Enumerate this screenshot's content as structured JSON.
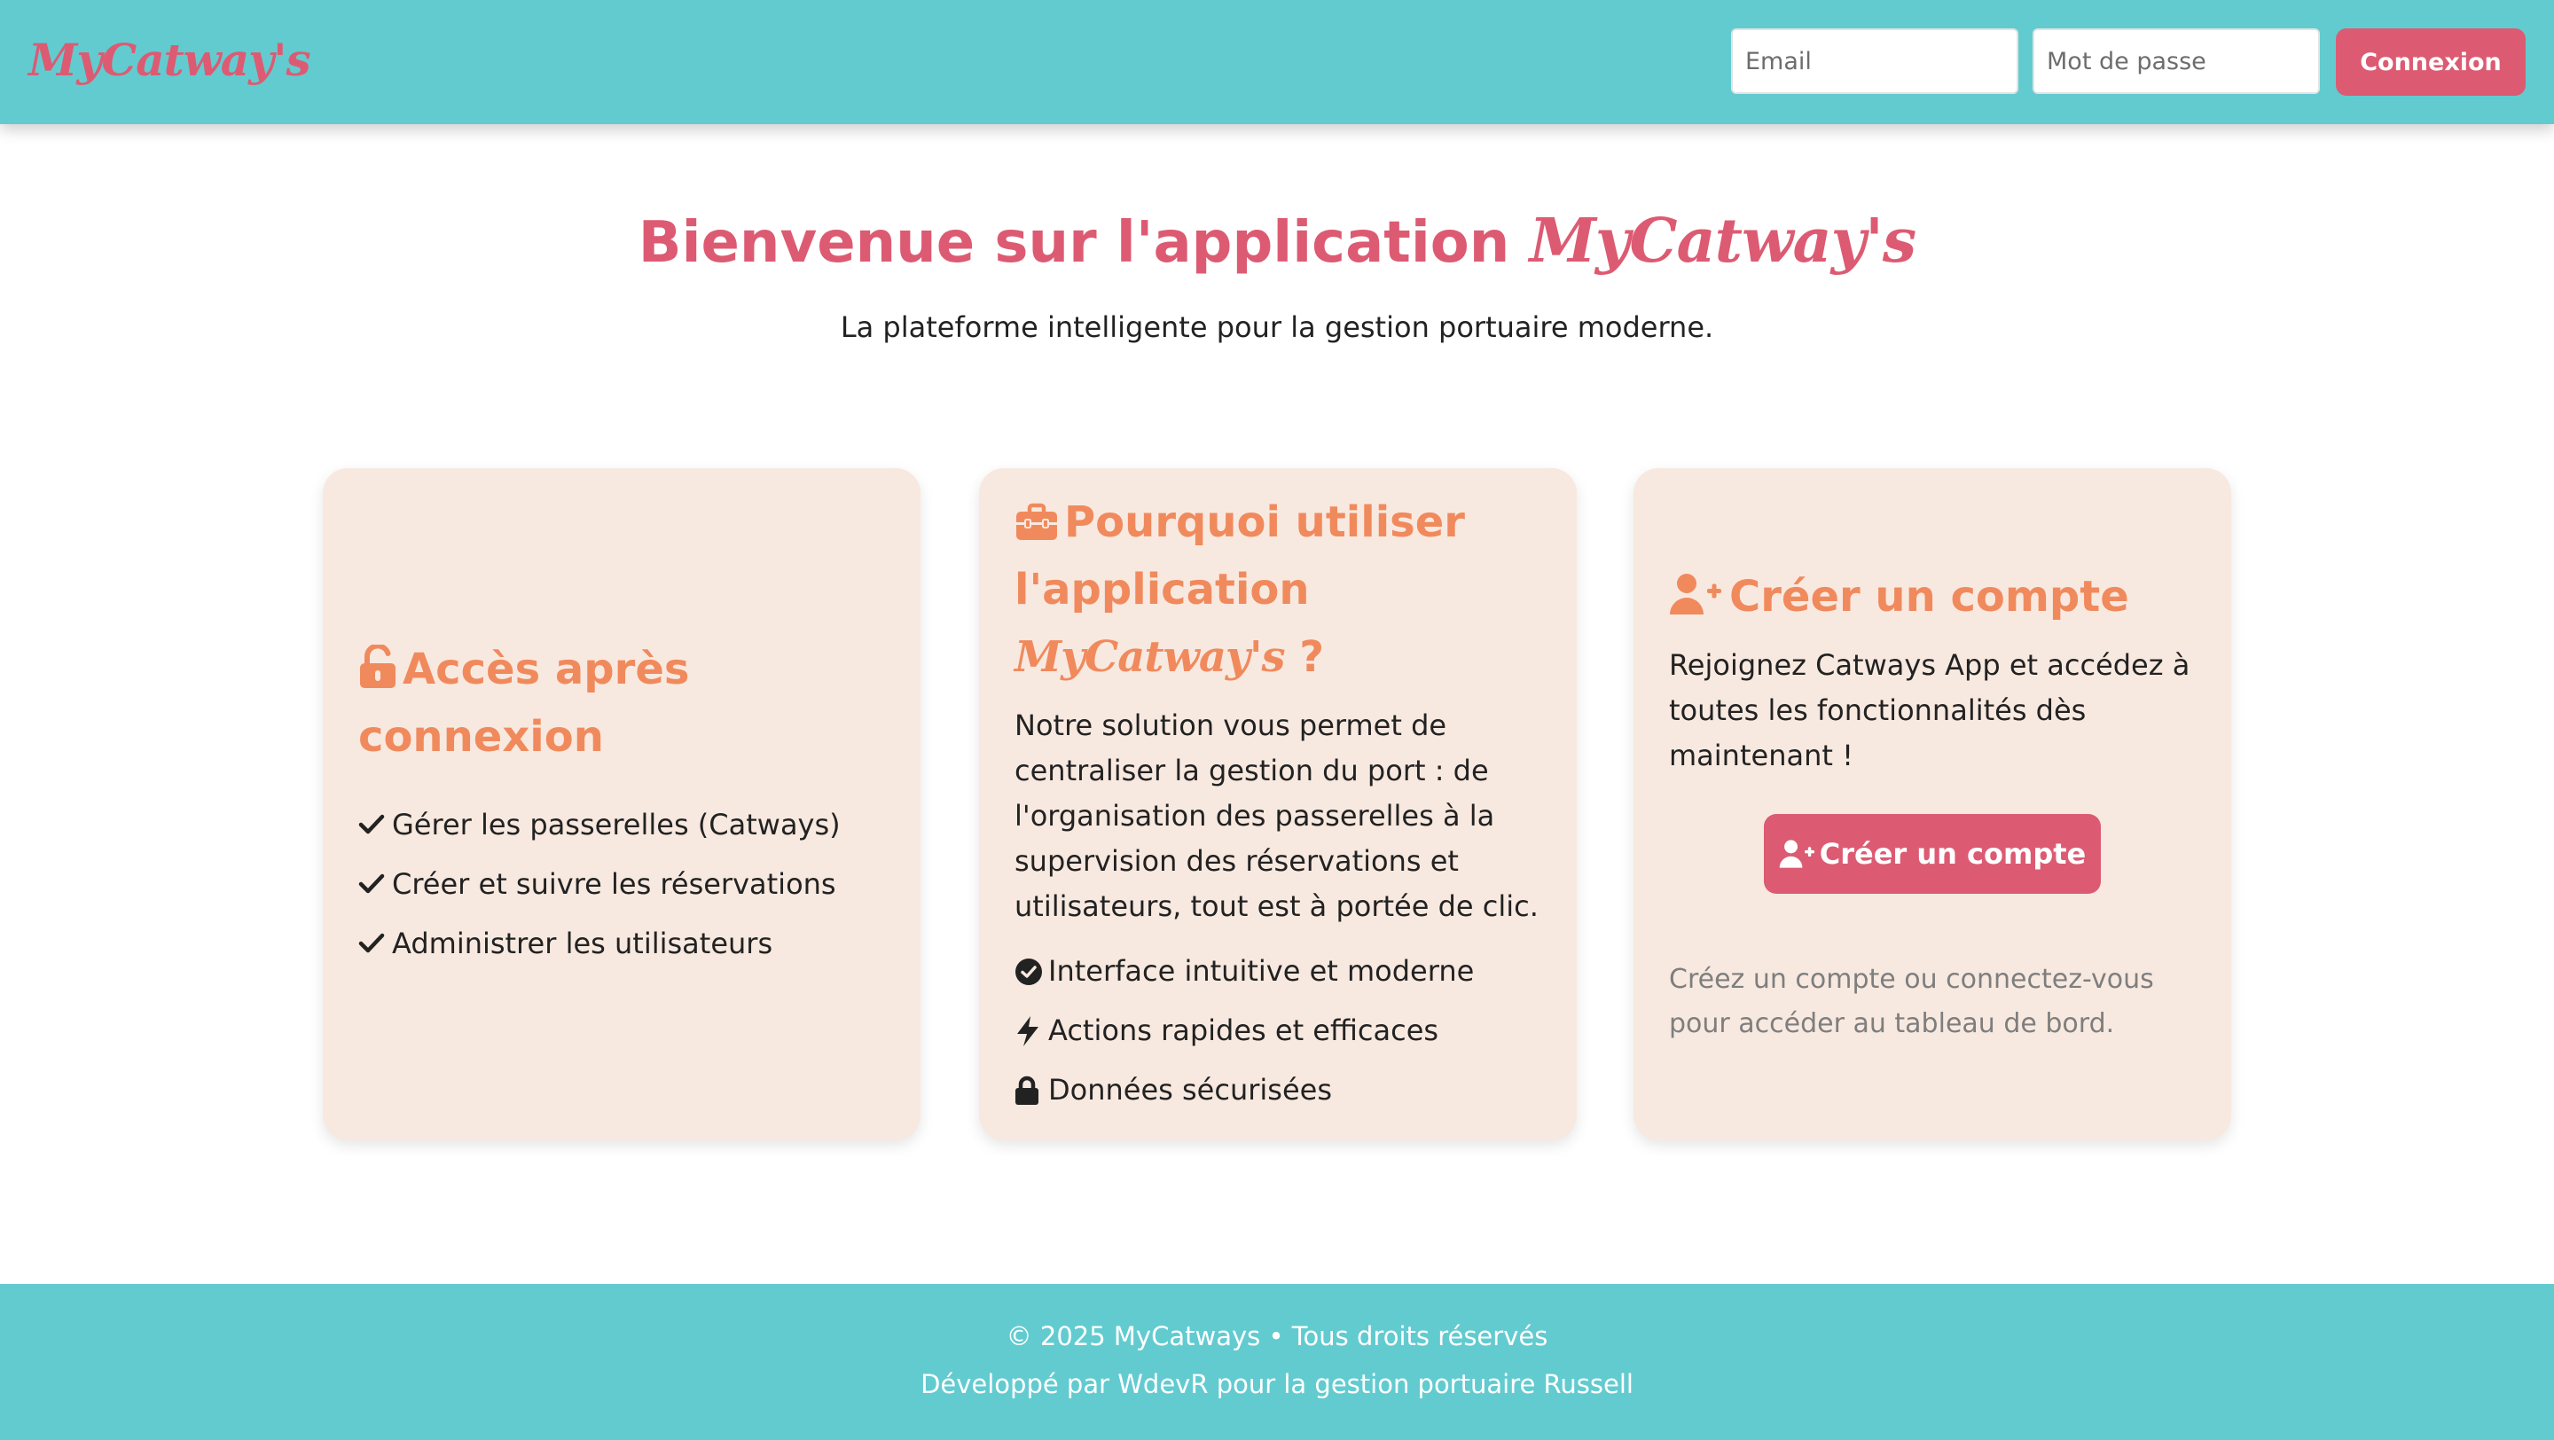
{
  "header": {
    "brand": "MyCatway's",
    "email_placeholder": "Email",
    "password_placeholder": "Mot de passe",
    "login_label": "Connexion"
  },
  "hero": {
    "title_prefix": "Bienvenue sur l'application",
    "title_brand": "MyCatway's",
    "subtitle": "La plateforme intelligente pour la gestion portuaire moderne."
  },
  "cards": [
    {
      "title": "Accès après connexion",
      "icon": "unlock-icon",
      "items": [
        {
          "icon": "check-icon",
          "text": "Gérer les passerelles (Catways)"
        },
        {
          "icon": "check-icon",
          "text": "Créer et suivre les réservations"
        },
        {
          "icon": "check-icon",
          "text": "Administrer les utilisateurs"
        }
      ]
    },
    {
      "title_prefix": "Pourquoi utiliser l'application",
      "title_brand": "MyCatway's",
      "title_suffix": "?",
      "icon": "toolbox-icon",
      "text": "Notre solution vous permet de centraliser la gestion du port : de l'organisation des passerelles à la supervision des réservations et utilisateurs, tout est à portée de clic.",
      "items": [
        {
          "icon": "check-circle-icon",
          "text": "Interface intuitive et moderne"
        },
        {
          "icon": "bolt-icon",
          "text": "Actions rapides et efficaces"
        },
        {
          "icon": "lock-icon",
          "text": "Données sécurisées"
        }
      ]
    },
    {
      "title": "Créer un compte",
      "icon": "user-plus-icon",
      "text": "Rejoignez Catways App et accédez à toutes les fonctionnalités dès maintenant !",
      "button_label": "Créer un compte",
      "hint": "Créez un compte ou connectez-vous pour accéder au tableau de bord."
    }
  ],
  "footer": {
    "line1": "© 2025 MyCatways • Tous droits réservés",
    "line2": "Développé par WdevR pour la gestion portuaire Russell"
  },
  "colors": {
    "header_bg": "#62cbd0",
    "brand_pink": "#dc5b72",
    "card_bg": "#f8e9e0",
    "card_title_orange": "#f08a5d",
    "hint_gray": "#7e7e7e"
  }
}
